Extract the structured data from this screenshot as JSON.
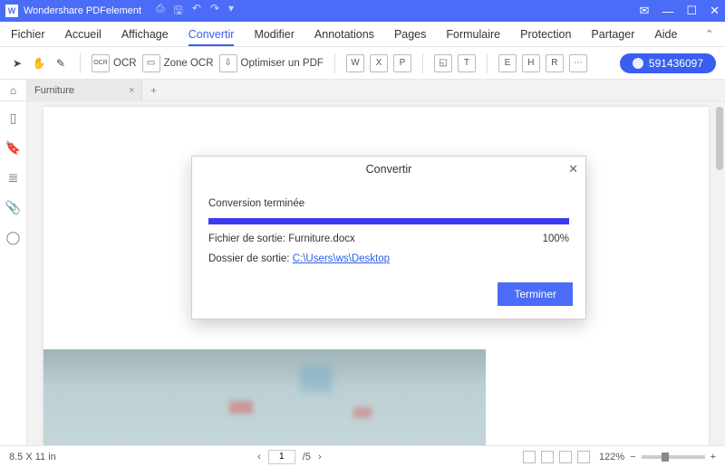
{
  "titlebar": {
    "app_name": "Wondershare PDFelement"
  },
  "menubar": {
    "items": [
      "Fichier",
      "Accueil",
      "Affichage",
      "Convertir",
      "Modifier",
      "Annotations",
      "Pages",
      "Formulaire",
      "Protection",
      "Partager",
      "Aide"
    ],
    "active_index": 3
  },
  "toolbar": {
    "ocr_label": "OCR",
    "zone_ocr_label": "Zone OCR",
    "optimize_label": "Optimiser un PDF"
  },
  "account": {
    "id": "591436097"
  },
  "tabs": {
    "items": [
      {
        "label": "Furniture"
      }
    ]
  },
  "modal": {
    "title": "Convertir",
    "status": "Conversion terminée",
    "output_file_label": "Fichier de sortie:",
    "output_file_value": "Furniture.docx",
    "percent": "100%",
    "output_folder_label": "Dossier de sortie:",
    "output_folder_link": "C:\\Users\\ws\\Desktop",
    "finish_label": "Terminer"
  },
  "status": {
    "page_size": "8.5 X 11 in",
    "page_current": "1",
    "page_sep": "/5",
    "zoom": "122%"
  }
}
